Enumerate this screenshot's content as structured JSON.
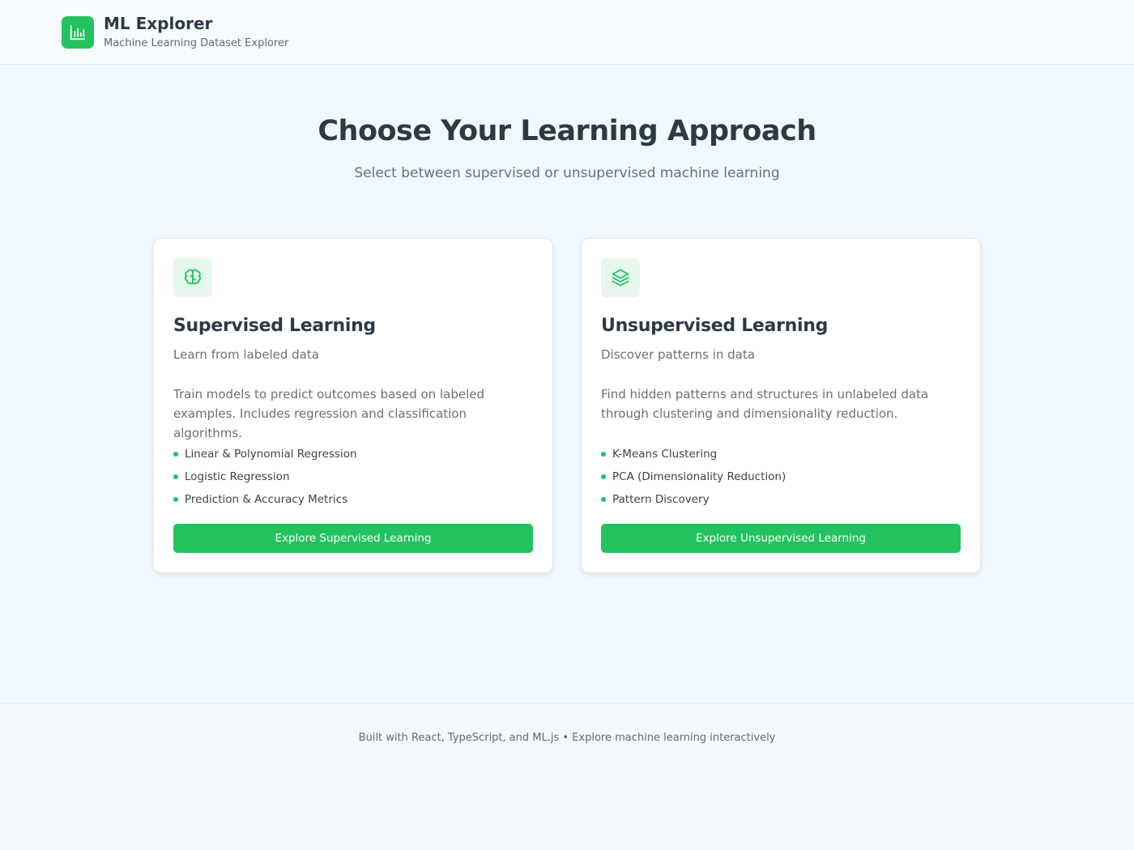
{
  "colors": {
    "accent": "#22c35e",
    "accent_soft": "#e6f7ec",
    "background": "#f0f7fd",
    "text_primary": "#2d3a45",
    "text_secondary": "#66717a"
  },
  "header": {
    "logo_icon": "bar-chart-icon",
    "title": "ML Explorer",
    "subtitle": "Machine Learning Dataset Explorer"
  },
  "hero": {
    "title": "Choose Your Learning Approach",
    "subtitle": "Select between supervised or unsupervised machine learning"
  },
  "cards": [
    {
      "icon": "brain-icon",
      "title": "Supervised Learning",
      "subtitle": "Learn from labeled data",
      "description": "Train models to predict outcomes based on labeled examples. Includes regression and classification algorithms.",
      "features": [
        "Linear & Polynomial Regression",
        "Logistic Regression",
        "Prediction & Accuracy Metrics"
      ],
      "button_label": "Explore Supervised Learning"
    },
    {
      "icon": "layers-icon",
      "title": "Unsupervised Learning",
      "subtitle": "Discover patterns in data",
      "description": "Find hidden patterns and structures in unlabeled data through clustering and dimensionality reduction.",
      "features": [
        "K-Means Clustering",
        "PCA (Dimensionality Reduction)",
        "Pattern Discovery"
      ],
      "button_label": "Explore Unsupervised Learning"
    }
  ],
  "footer": {
    "text": "Built with React, TypeScript, and ML.js • Explore machine learning interactively"
  }
}
